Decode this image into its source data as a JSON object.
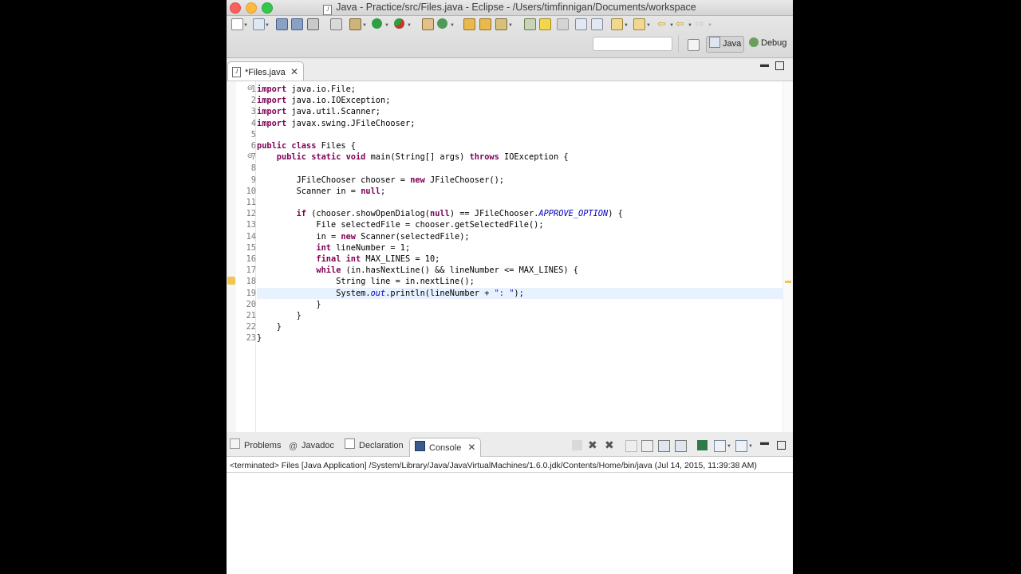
{
  "window": {
    "title": "Java - Practice/src/Files.java - Eclipse - /Users/timfinnigan/Documents/workspace"
  },
  "perspectives": [
    {
      "label": "Java",
      "active": true
    },
    {
      "label": "Debug",
      "active": false
    }
  ],
  "editor": {
    "tab_label": "*Files.java",
    "line_numbers": [
      "1",
      "2",
      "3",
      "4",
      "5",
      "6",
      "7",
      "8",
      "9",
      "10",
      "11",
      "12",
      "13",
      "14",
      "15",
      "16",
      "17",
      "18",
      "19",
      "20",
      "21",
      "22",
      "23"
    ],
    "lines": [
      [
        {
          "t": "import ",
          "c": "kw"
        },
        {
          "t": "java.io.File;"
        }
      ],
      [
        {
          "t": "import ",
          "c": "kw"
        },
        {
          "t": "java.io.IOException;"
        }
      ],
      [
        {
          "t": "import ",
          "c": "kw"
        },
        {
          "t": "java.util.Scanner;"
        }
      ],
      [
        {
          "t": "import ",
          "c": "kw"
        },
        {
          "t": "javax.swing.JFileChooser;"
        }
      ],
      [],
      [
        {
          "t": "public class ",
          "c": "kw"
        },
        {
          "t": "Files {"
        }
      ],
      [
        {
          "t": "    public static void ",
          "c": "kw"
        },
        {
          "t": "main(String[] args) "
        },
        {
          "t": "throws ",
          "c": "kw"
        },
        {
          "t": "IOException {"
        }
      ],
      [],
      [
        {
          "t": "        JFileChooser chooser = "
        },
        {
          "t": "new ",
          "c": "kw"
        },
        {
          "t": "JFileChooser();"
        }
      ],
      [
        {
          "t": "        Scanner in = "
        },
        {
          "t": "null",
          "c": "kw"
        },
        {
          "t": ";"
        }
      ],
      [],
      [
        {
          "t": "        if ",
          "c": "kw"
        },
        {
          "t": "(chooser.showOpenDialog("
        },
        {
          "t": "null",
          "c": "kw"
        },
        {
          "t": ") == JFileChooser."
        },
        {
          "t": "APPROVE_OPTION",
          "c": "fld"
        },
        {
          "t": ") {"
        }
      ],
      [
        {
          "t": "            File selectedFile = chooser.getSelectedFile();"
        }
      ],
      [
        {
          "t": "            in = "
        },
        {
          "t": "new ",
          "c": "kw"
        },
        {
          "t": "Scanner(selectedFile);"
        }
      ],
      [
        {
          "t": "            int ",
          "c": "kw"
        },
        {
          "t": "lineNumber = 1;"
        }
      ],
      [
        {
          "t": "            final int ",
          "c": "kw"
        },
        {
          "t": "MAX_LINES = 10;"
        }
      ],
      [
        {
          "t": "            while ",
          "c": "kw"
        },
        {
          "t": "(in.hasNextLine() && lineNumber <= MAX_LINES) {"
        }
      ],
      [
        {
          "t": "                String line = in.nextLine();"
        }
      ],
      [
        {
          "t": "                System."
        },
        {
          "t": "out",
          "c": "fld"
        },
        {
          "t": ".println(lineNumber + "
        },
        {
          "t": "\": \"",
          "c": "str"
        },
        {
          "t": ");"
        }
      ],
      [
        {
          "t": "            }"
        }
      ],
      [
        {
          "t": "        }"
        }
      ],
      [
        {
          "t": "    }"
        }
      ],
      [
        {
          "t": "}"
        }
      ]
    ]
  },
  "bottom_panel": {
    "tabs": [
      {
        "label": "Problems",
        "icon": "problems-icon"
      },
      {
        "label": "Javadoc",
        "icon": "javadoc-icon"
      },
      {
        "label": "Declaration",
        "icon": "declaration-icon"
      },
      {
        "label": "Console",
        "icon": "console-icon",
        "active": true
      }
    ],
    "console_status": "<terminated> Files [Java Application] /System/Library/Java/JavaVirtualMachines/1.6.0.jdk/Contents/Home/bin/java (Jul 14, 2015, 11:39:38 AM)"
  },
  "colors": {
    "keyword": "#7f0055",
    "static_field": "#0000c0",
    "string": "#2a00ff",
    "current_line": "#e8f2fe"
  }
}
